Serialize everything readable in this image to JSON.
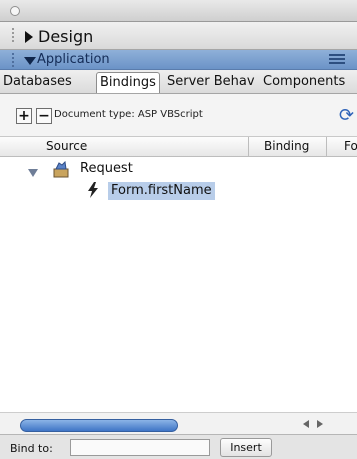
{
  "panel": {
    "design": {
      "label": "Design"
    },
    "application": {
      "label": "Application"
    },
    "tabs": [
      {
        "label": "Databases"
      },
      {
        "label": "Bindings"
      },
      {
        "label": "Server Behav"
      },
      {
        "label": "Components"
      }
    ],
    "toolbar": {
      "add_label": "+",
      "remove_label": "−",
      "document_type": "Document type: ASP VBScript",
      "refresh_icon": "refresh-icon"
    },
    "table": {
      "columns": [
        "Source",
        "Binding",
        "Fo"
      ],
      "tree": {
        "parent": "Request",
        "child": "Form.firstName"
      }
    },
    "footer": {
      "bind_to_label": "Bind to:",
      "insert_label": "Insert"
    },
    "colors": {
      "application_header": "#6b93c7",
      "selection": "#b8cde9",
      "scroll_thumb": "#3f75c6"
    }
  }
}
